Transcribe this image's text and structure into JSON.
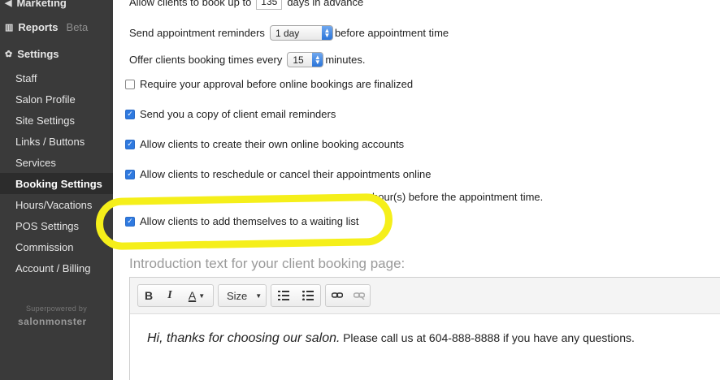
{
  "sidebar": {
    "top_items": [
      {
        "label": "Marketing",
        "icon": "megaphone-icon"
      },
      {
        "label": "Reports",
        "badge": "Beta",
        "icon": "chart-icon"
      },
      {
        "label": "Settings",
        "icon": "gear-icon"
      }
    ],
    "sub_items": [
      {
        "label": "Staff"
      },
      {
        "label": "Salon Profile"
      },
      {
        "label": "Site Settings"
      },
      {
        "label": "Links / Buttons"
      },
      {
        "label": "Services"
      },
      {
        "label": "Booking Settings",
        "active": true
      },
      {
        "label": "Hours/Vacations"
      },
      {
        "label": "POS Settings"
      },
      {
        "label": "Commission"
      },
      {
        "label": "Account / Billing"
      }
    ],
    "powered_by": "Superpowered by",
    "logo_text": "salonmonster"
  },
  "settings": {
    "advance": {
      "prefix": "Allow clients to book up to",
      "value": "135",
      "suffix": "days in advance"
    },
    "reminders": {
      "prefix": "Send appointment reminders",
      "value": "1 day",
      "suffix": "before appointment time"
    },
    "interval": {
      "prefix": "Offer clients booking times every",
      "value": "15",
      "suffix": "minutes."
    },
    "checkboxes": [
      {
        "label": "Require your approval before online bookings are finalized",
        "checked": false
      },
      {
        "label": "Send you a copy of client email reminders",
        "checked": true
      },
      {
        "label": "Allow clients to create their own online booking accounts",
        "checked": true
      },
      {
        "label": "Allow clients to reschedule or cancel their appointments online",
        "checked": true
      }
    ],
    "reschedule_suffix": "hour(s) before the appointment time.",
    "waiting_list": {
      "label": "Allow clients to add themselves to a waiting list",
      "checked": true
    }
  },
  "intro": {
    "heading": "Introduction text for your client booking page:",
    "toolbar": {
      "bold": "B",
      "italic": "I",
      "color": "A",
      "size": "Size"
    },
    "body_italic": "Hi, thanks for choosing our salon.",
    "body_plain": "Please call us at 604-888-8888 if you have any questions."
  },
  "colors": {
    "sidebar_bg": "#3a3a3a",
    "highlight": "#f5ef1a",
    "checkbox_blue": "#2f7ae0"
  }
}
